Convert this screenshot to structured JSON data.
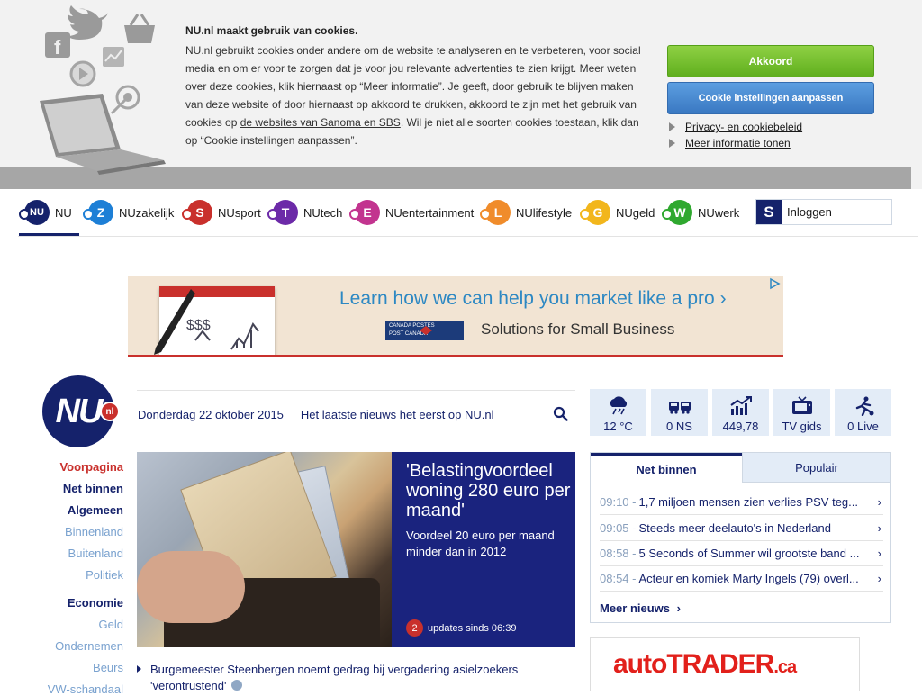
{
  "cookie": {
    "title": "NU.nl maakt gebruik van cookies.",
    "text_part1": "NU.nl gebruikt cookies onder andere om de website te analyseren en te verbeteren, voor social media en om er voor te zorgen dat je voor jou relevante advertenties te zien krijgt. Meer weten over deze cookies, klik hiernaast op “Meer informatie”. Je geeft, door gebruik te blijven maken van deze website of door hiernaast op akkoord te drukken, akkoord te zijn met het gebruik van cookies op ",
    "text_link": "de websites van Sanoma en SBS",
    "text_part2": ". Wil je niet alle soorten cookies toestaan, klik dan op “Cookie instellingen aanpassen”.",
    "accept_label": "Akkoord",
    "settings_label": "Cookie instellingen aanpassen",
    "privacy_link": "Privacy- en cookiebeleid",
    "more_info_link": "Meer informatie tonen"
  },
  "topnav": {
    "items": [
      {
        "letter": "NU",
        "label": "NU",
        "color": "#15226b"
      },
      {
        "letter": "Z",
        "label": "NUzakelijk",
        "color": "#1d7fd6"
      },
      {
        "letter": "S",
        "label": "NUsport",
        "color": "#c9302c"
      },
      {
        "letter": "T",
        "label": "NUtech",
        "color": "#6c2aa8"
      },
      {
        "letter": "E",
        "label": "NUentertainment",
        "color": "#c2348f"
      },
      {
        "letter": "L",
        "label": "NUlifestyle",
        "color": "#f08c2b"
      },
      {
        "letter": "G",
        "label": "NUgeld",
        "color": "#f2b61c"
      },
      {
        "letter": "W",
        "label": "NUwerk",
        "color": "#2fa82f"
      }
    ],
    "login_letter": "S",
    "login_label": "Inloggen"
  },
  "ad": {
    "headline": "Learn how we can help you market like a pro  ›",
    "sub": "Solutions for Small Business",
    "brand_line1": "CANADA  POSTES",
    "brand_line2": "POST     CANADA"
  },
  "logo": {
    "main": "NU",
    "suffix": "nl"
  },
  "sidenav": {
    "voorpagina": "Voorpagina",
    "net_binnen": "Net binnen",
    "algemeen": "Algemeen",
    "binnenland": "Binnenland",
    "buitenland": "Buitenland",
    "politiek": "Politiek",
    "economie": "Economie",
    "geld": "Geld",
    "ondernemen": "Ondernemen",
    "beurs": "Beurs",
    "vw": "VW-schandaal"
  },
  "datebar": {
    "date": "Donderdag 22 oktober 2015",
    "tagline": "Het laatste nieuws het eerst op NU.nl"
  },
  "hero": {
    "headline": "'Belastingvoordeel woning 280 euro per maand'",
    "subline": "Voordeel 20 euro per maand minder dan in 2012",
    "update_count": "2",
    "update_text": "updates sinds 06:39"
  },
  "story": {
    "line1": "Burgemeester Steenbergen noemt gedrag bij vergadering asielzoekers",
    "line2": "'verontrustend'"
  },
  "widgets": [
    {
      "icon": "weather-icon",
      "value": "12 °C"
    },
    {
      "icon": "train-icon",
      "value": "0 NS"
    },
    {
      "icon": "stock-chart-icon",
      "value": "449,78"
    },
    {
      "icon": "tv-icon",
      "value": "TV gids"
    },
    {
      "icon": "live-sport-icon",
      "value": "0 Live"
    }
  ],
  "newsbox": {
    "tab_active": "Net binnen",
    "tab_other": "Populair",
    "items": [
      {
        "time": "09:10 -",
        "title": "1,7 miljoen mensen zien verlies PSV teg..."
      },
      {
        "time": "09:05 -",
        "title": "Steeds meer deelauto's in Nederland"
      },
      {
        "time": "08:58 -",
        "title": "5 Seconds of Summer wil grootste band ..."
      },
      {
        "time": "08:54 -",
        "title": "Acteur en komiek Marty Ingels (79) overl..."
      }
    ],
    "more": "Meer nieuws"
  },
  "autotrader": {
    "auto": "auto",
    "trader": "TRADER",
    "ca": ".ca"
  }
}
